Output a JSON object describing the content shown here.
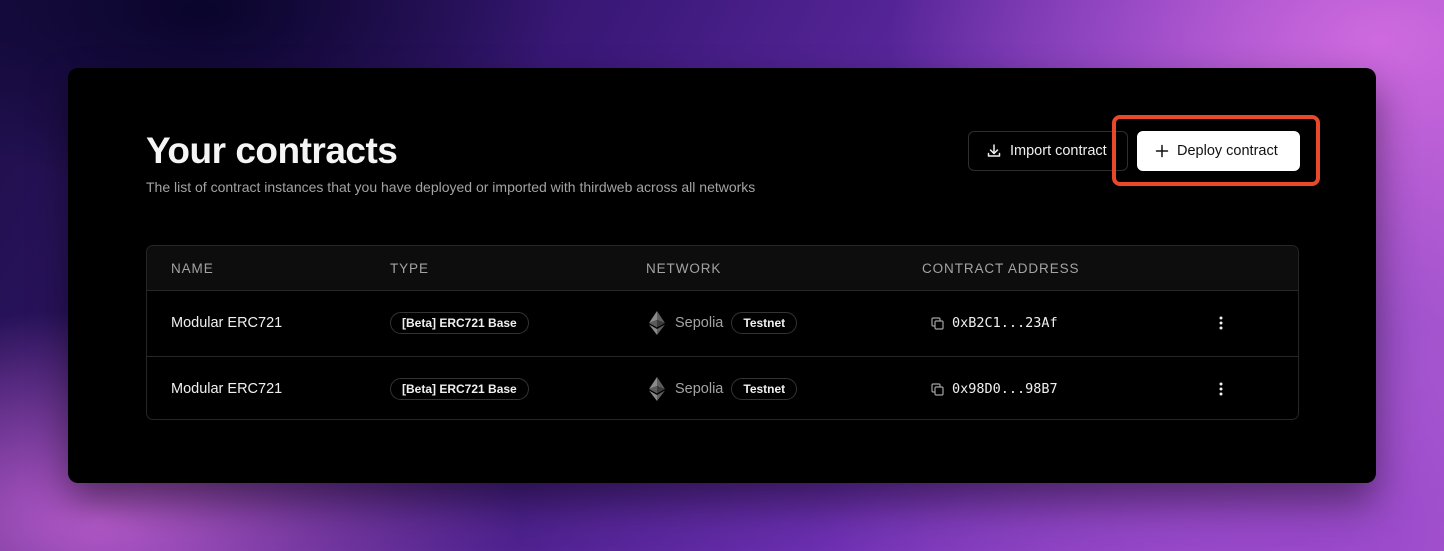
{
  "header": {
    "title": "Your contracts",
    "subtitle": "The list of contract instances that you have deployed or imported with thirdweb across all networks"
  },
  "actions": {
    "import_label": "Import contract",
    "deploy_label": "Deploy contract",
    "import_icon": "download-icon",
    "deploy_icon": "plus-icon"
  },
  "table": {
    "columns": [
      "NAME",
      "TYPE",
      "NETWORK",
      "CONTRACT ADDRESS"
    ],
    "rows": [
      {
        "name": "Modular ERC721",
        "type": "[Beta] ERC721 Base",
        "network": "Sepolia",
        "network_badge": "Testnet",
        "network_icon": "ethereum-icon",
        "address": "0xB2C1...23Af"
      },
      {
        "name": "Modular ERC721",
        "type": "[Beta] ERC721 Base",
        "network": "Sepolia",
        "network_badge": "Testnet",
        "network_icon": "ethereum-icon",
        "address": "0x98D0...98B7"
      }
    ]
  },
  "colors": {
    "panel_background": "#000000",
    "highlight": "#e8492a",
    "deploy_button": "#ffffff"
  }
}
